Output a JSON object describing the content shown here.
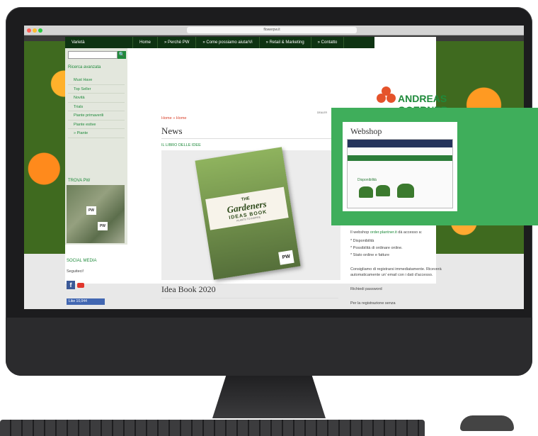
{
  "browser": {
    "url": "flowerpw.it"
  },
  "nav": {
    "varieta": "Varietà",
    "items": [
      "Home",
      "» Perchè PW",
      "» Come possiamo aiutarVi",
      "» Retail & Marketing",
      "» Contatto"
    ]
  },
  "sidebar": {
    "search_button": "🔍",
    "ricerca_avanzata": "Ricerca avanzata",
    "menu": [
      "Must Have",
      "Top Seller",
      "Novità",
      "Trials",
      "Piante primaverili",
      "Piante estive",
      "» Piante"
    ],
    "trova_pw": "TROVA PW",
    "map_pin_1": "PW",
    "map_pin_2": "PW",
    "social_media": "SOCIAL MEDIA",
    "seguici": "Seguiteci!",
    "fb": "f",
    "like": "Like 10,044"
  },
  "main": {
    "breadcrumb": "Home » Home",
    "page_title": "News",
    "section_label": "IL LIBRO DELLE IDEE",
    "book": {
      "line1": "THE",
      "line2": "Gardeners",
      "line3": "IDEAS BOOK",
      "sub": "PLANTS TO INSPIRE",
      "pw": "PW"
    },
    "idea_title": "Idea Book 2020"
  },
  "right": {
    "logo": "ANDREAS",
    "logo_line2": "GOERNER",
    "small_link": "DEALER",
    "webshop_title": "Webshop",
    "webshop_label": "Disponibilità",
    "p1_prefix": "Il webshop ",
    "p1_link": "order.plantner.it",
    "p1_suffix": " dà accesso a:",
    "bullets": [
      "* Disponibilità",
      "* Possibilità di ordinare online.",
      "* Stato ordine e fatture"
    ],
    "p2": "Consigliamo di registrarsi immediatamente. Riceverà automaticamente un' email con i dati d'accesso.",
    "p2_link": "Richiedi password",
    "p3": "Per la registrazione senza"
  },
  "colors": {
    "brand_green": "#1f8a3b",
    "nav_dark": "#0e3312",
    "accent_orange": "#e5532b",
    "webshop_green": "#3fae5b"
  }
}
